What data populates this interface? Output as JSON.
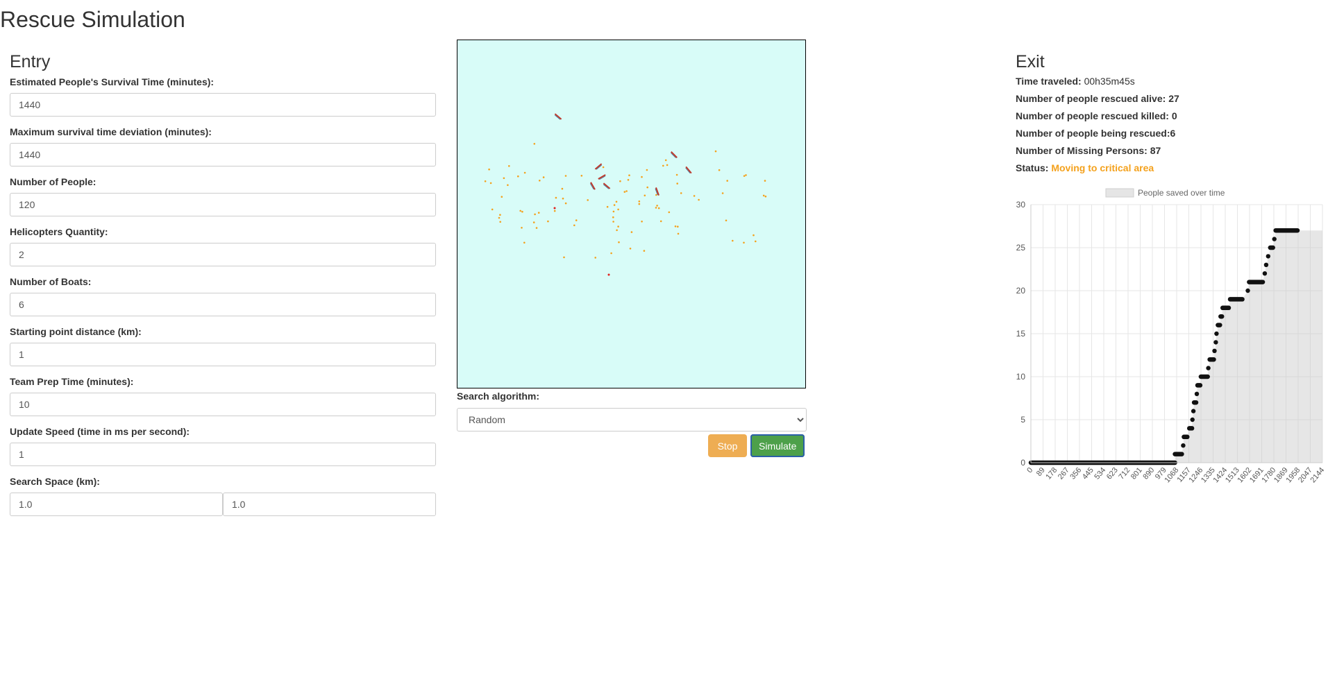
{
  "page_title": "Rescue Simulation",
  "entry": {
    "heading": "Entry",
    "fields": [
      {
        "label": "Estimated People's Survival Time (minutes):",
        "value": "1440"
      },
      {
        "label": "Maximum survival time deviation (minutes):",
        "value": "1440"
      },
      {
        "label": "Number of People:",
        "value": "120"
      },
      {
        "label": "Helicopters Quantity:",
        "value": "2"
      },
      {
        "label": "Number of Boats:",
        "value": "6"
      },
      {
        "label": "Starting point distance (km):",
        "value": "1"
      },
      {
        "label": "Team Prep Time (minutes):",
        "value": "10"
      },
      {
        "label": "Update Speed (time in ms per second):",
        "value": "1"
      }
    ],
    "search_space": {
      "label": "Search Space (km):",
      "x": "1.0",
      "y": "1.0"
    }
  },
  "simulation": {
    "algorithm_label": "Search algorithm:",
    "algorithm_value": "Random",
    "stop_label": "Stop",
    "simulate_label": "Simulate",
    "colors": {
      "water": "#d8fcf8",
      "person": "#f4a11c",
      "critical": "#e0201c"
    }
  },
  "exit": {
    "heading": "Exit",
    "time_label": "Time traveled:",
    "time_value": "00h35m45s",
    "rescued_alive_label": "Number of people rescued alive:",
    "rescued_alive_value": "27",
    "rescued_killed_label": "Number of people rescued killed:",
    "rescued_killed_value": "0",
    "being_rescued_label": "Number of people being rescued:",
    "being_rescued_value": "6",
    "missing_label": "Number of Missing Persons:",
    "missing_value": "87",
    "status_label": "Status:",
    "status_value": "Moving to critical area",
    "status_color": "#f4a11c"
  },
  "chart_data": {
    "type": "scatter",
    "legend": "People saved over time",
    "legend_position": "top-center",
    "grid": true,
    "ylim": [
      0,
      30
    ],
    "yticks": [
      0,
      5,
      10,
      15,
      20,
      25,
      30
    ],
    "xticks": [
      "0",
      "89",
      "178",
      "267",
      "356",
      "445",
      "534",
      "623",
      "712",
      "801",
      "890",
      "979",
      "1068",
      "1157",
      "1246",
      "1335",
      "1424",
      "1513",
      "1602",
      "1691",
      "1780",
      "1869",
      "1958",
      "2047",
      "2144"
    ],
    "xlim": [
      0,
      2144
    ],
    "steps": [
      {
        "x_start": 0,
        "x_end": 1060,
        "y": 0
      },
      {
        "x_start": 1060,
        "x_end": 1110,
        "y": 1
      },
      {
        "x_start": 1120,
        "x_end": 1120,
        "y": 2
      },
      {
        "x_start": 1125,
        "x_end": 1150,
        "y": 3
      },
      {
        "x_start": 1165,
        "x_end": 1185,
        "y": 4
      },
      {
        "x_start": 1188,
        "x_end": 1188,
        "y": 5
      },
      {
        "x_start": 1195,
        "x_end": 1195,
        "y": 6
      },
      {
        "x_start": 1200,
        "x_end": 1215,
        "y": 7
      },
      {
        "x_start": 1220,
        "x_end": 1220,
        "y": 8
      },
      {
        "x_start": 1225,
        "x_end": 1245,
        "y": 9
      },
      {
        "x_start": 1250,
        "x_end": 1300,
        "y": 10
      },
      {
        "x_start": 1305,
        "x_end": 1310,
        "y": 11
      },
      {
        "x_start": 1315,
        "x_end": 1345,
        "y": 12
      },
      {
        "x_start": 1350,
        "x_end": 1355,
        "y": 13
      },
      {
        "x_start": 1360,
        "x_end": 1360,
        "y": 14
      },
      {
        "x_start": 1365,
        "x_end": 1370,
        "y": 15
      },
      {
        "x_start": 1375,
        "x_end": 1390,
        "y": 16
      },
      {
        "x_start": 1395,
        "x_end": 1405,
        "y": 17
      },
      {
        "x_start": 1410,
        "x_end": 1455,
        "y": 18
      },
      {
        "x_start": 1465,
        "x_end": 1555,
        "y": 19
      },
      {
        "x_start": 1595,
        "x_end": 1595,
        "y": 20
      },
      {
        "x_start": 1605,
        "x_end": 1705,
        "y": 21
      },
      {
        "x_start": 1720,
        "x_end": 1720,
        "y": 22
      },
      {
        "x_start": 1730,
        "x_end": 1735,
        "y": 23
      },
      {
        "x_start": 1745,
        "x_end": 1750,
        "y": 24
      },
      {
        "x_start": 1760,
        "x_end": 1780,
        "y": 25
      },
      {
        "x_start": 1790,
        "x_end": 1795,
        "y": 26
      },
      {
        "x_start": 1800,
        "x_end": 1960,
        "y": 27
      }
    ]
  }
}
